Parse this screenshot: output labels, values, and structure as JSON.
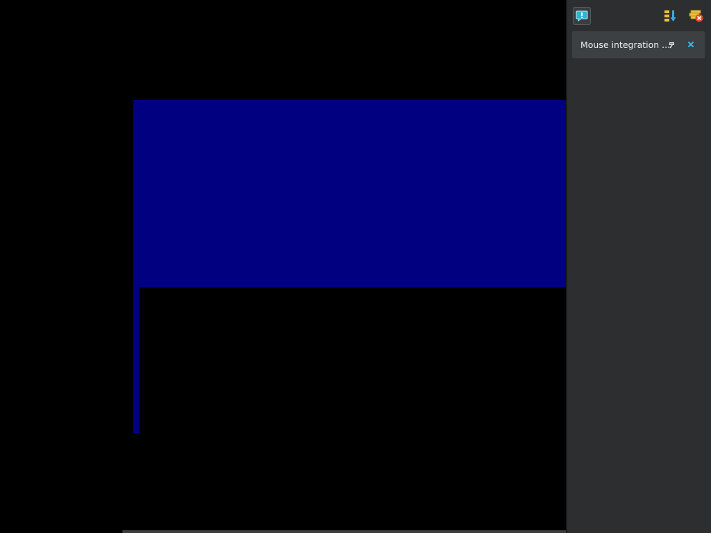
{
  "guest": {
    "colors": {
      "background": "#000000",
      "blue": "#000080"
    }
  },
  "notification_center": {
    "toolbar": {
      "alert_icon": "alert-bubble-icon",
      "sort_icon": "sort-down-icon",
      "clear_icon": "clear-all-icon"
    },
    "items": [
      {
        "text": "Mouse integration ...",
        "pin_icon": "pin-icon",
        "close_icon": "close-icon"
      }
    ]
  }
}
